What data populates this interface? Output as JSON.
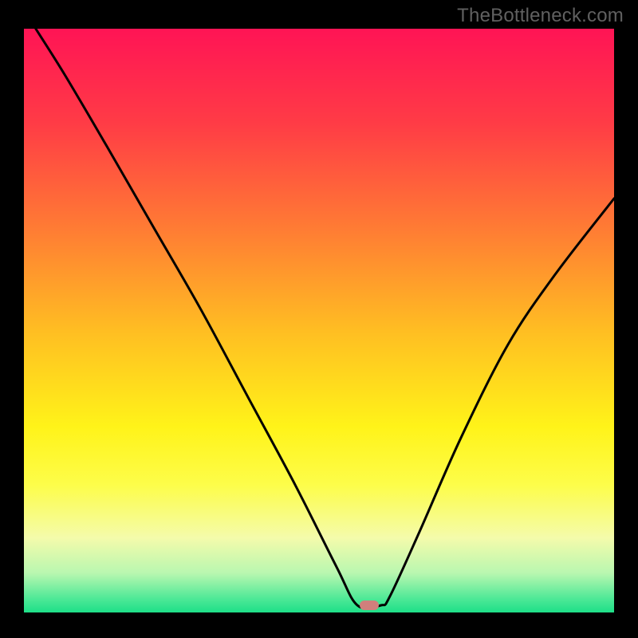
{
  "watermark": "TheBottleneck.com",
  "chart_data": {
    "type": "line",
    "title": "",
    "xlabel": "",
    "ylabel": "",
    "xlim": [
      0,
      100
    ],
    "ylim": [
      0,
      100
    ],
    "grid": false,
    "curve_points": [
      {
        "x": 2,
        "y": 100
      },
      {
        "x": 7,
        "y": 92
      },
      {
        "x": 14,
        "y": 80
      },
      {
        "x": 22,
        "y": 66
      },
      {
        "x": 30,
        "y": 52
      },
      {
        "x": 38,
        "y": 37
      },
      {
        "x": 46,
        "y": 22
      },
      {
        "x": 53,
        "y": 8
      },
      {
        "x": 56.5,
        "y": 1.5
      },
      {
        "x": 60.5,
        "y": 1.5
      },
      {
        "x": 62,
        "y": 3
      },
      {
        "x": 67,
        "y": 14
      },
      {
        "x": 74,
        "y": 30
      },
      {
        "x": 82,
        "y": 46
      },
      {
        "x": 90,
        "y": 58
      },
      {
        "x": 100,
        "y": 71
      }
    ],
    "marker_points": [
      {
        "x": 58.5,
        "y": 1.5
      }
    ],
    "gradient_stops": [
      {
        "pct": 0,
        "color": "#ff1455"
      },
      {
        "pct": 16,
        "color": "#ff3b46"
      },
      {
        "pct": 34,
        "color": "#ff7b34"
      },
      {
        "pct": 52,
        "color": "#ffbf22"
      },
      {
        "pct": 68,
        "color": "#fff319"
      },
      {
        "pct": 78,
        "color": "#fdfd4a"
      },
      {
        "pct": 87,
        "color": "#f4fbab"
      },
      {
        "pct": 93,
        "color": "#b9f7b0"
      },
      {
        "pct": 97.5,
        "color": "#4be896"
      },
      {
        "pct": 100,
        "color": "#18de86"
      }
    ],
    "marker_color": "#d07f7c",
    "line_color": "#000000"
  }
}
